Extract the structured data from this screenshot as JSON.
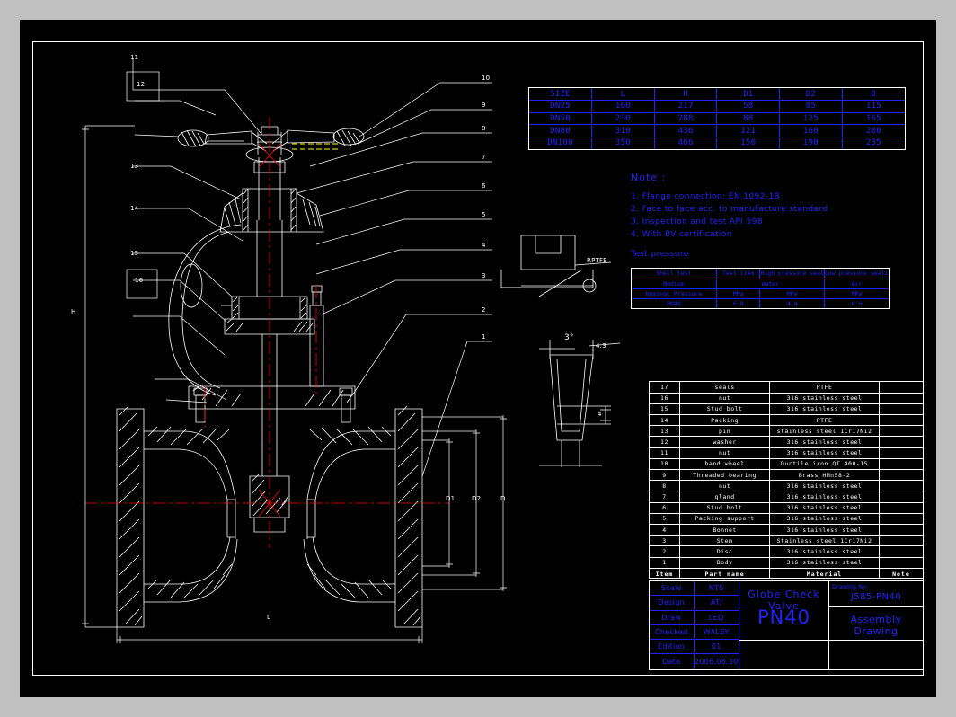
{
  "document": {
    "kind": "cad-drawing",
    "sheet_background": "#000000",
    "page_background": "#c0c0c0",
    "line_color": "#ffffff",
    "text_color_blue": "#2222ff",
    "centerline_color": "#ff0000",
    "accent_yellow": "#ffff00"
  },
  "size_table": {
    "headers": [
      "SIZE",
      "L",
      "H",
      "D1",
      "D2",
      "D"
    ],
    "rows": [
      [
        "DN25",
        "160",
        "217",
        "58",
        "85",
        "115"
      ],
      [
        "DN50",
        "230",
        "288",
        "88",
        "125",
        "165"
      ],
      [
        "DN80",
        "310",
        "436",
        "121",
        "160",
        "200"
      ],
      [
        "DN100",
        "350",
        "466",
        "150",
        "190",
        "235"
      ]
    ]
  },
  "notes": {
    "title": "Note :",
    "lines": [
      "1. Flange connection: EN 1092-1B",
      "2. Face to face acc. to manufacture standard",
      "3. Inspection and test  API 598",
      "4. With BV certification"
    ],
    "test_pressure_label": "Test pressure"
  },
  "test_pressure_table": {
    "headers": [
      "Shell test",
      "Test item",
      "High pressure sealing test",
      "Low pressure sealing test"
    ],
    "rows": [
      [
        "Medium",
        "Water",
        "Water",
        "Air"
      ],
      [
        "Nominal Pressure",
        "MPa",
        "MPa",
        "MPa"
      ],
      [
        "PN40",
        "6.0",
        "4.4",
        "0.6"
      ]
    ]
  },
  "bom": {
    "column_headers": [
      "Item",
      "Part name",
      "Material",
      "Note"
    ],
    "rows": [
      {
        "item": "17",
        "name": "seals",
        "material": "PTFE",
        "note": ""
      },
      {
        "item": "16",
        "name": "nut",
        "material": "316 stainless steel",
        "note": ""
      },
      {
        "item": "15",
        "name": "Stud bolt",
        "material": "316 stainless steel",
        "note": ""
      },
      {
        "item": "14",
        "name": "Packing",
        "material": "PTFE",
        "note": ""
      },
      {
        "item": "13",
        "name": "pin",
        "material": "stainless steel 1Cr17Ni2",
        "note": ""
      },
      {
        "item": "12",
        "name": "washer",
        "material": "316 stainless steel",
        "note": ""
      },
      {
        "item": "11",
        "name": "nut",
        "material": "316 stainless steel",
        "note": ""
      },
      {
        "item": "10",
        "name": "hand wheel",
        "material": "Ductile iron QT 400-15",
        "note": ""
      },
      {
        "item": "9",
        "name": "Threaded bearing",
        "material": "Brass HMn58-2",
        "note": ""
      },
      {
        "item": "8",
        "name": "nut",
        "material": "316 stainless steel",
        "note": ""
      },
      {
        "item": "7",
        "name": "gland",
        "material": "316 stainless steel",
        "note": ""
      },
      {
        "item": "6",
        "name": "Stud bolt",
        "material": "316 stainless steel",
        "note": ""
      },
      {
        "item": "5",
        "name": "Packing support",
        "material": "316 stainless steel",
        "note": ""
      },
      {
        "item": "4",
        "name": "Bonnet",
        "material": "316 stainless steel",
        "note": ""
      },
      {
        "item": "3",
        "name": "Stem",
        "material": "Stainless steel 1Cr17Ni2",
        "note": ""
      },
      {
        "item": "2",
        "name": "Disc",
        "material": "316 stainless steel",
        "note": ""
      },
      {
        "item": "1",
        "name": "Body",
        "material": "316 stainless steel",
        "note": ""
      }
    ]
  },
  "title_block": {
    "fields": [
      {
        "key": "Scale",
        "value": "NTS"
      },
      {
        "key": "Design",
        "value": "ATJ"
      },
      {
        "key": "Draw",
        "value": "LEQ"
      },
      {
        "key": "Checked",
        "value": "WALEY"
      },
      {
        "key": "Edition",
        "value": "01"
      },
      {
        "key": "Date",
        "value": "2006.08.30"
      }
    ],
    "product_name": "Globe Check  Valve",
    "product_rating": "PN40",
    "drawing_no_label": "Drawing No.",
    "drawing_no_value": "J585-PN40",
    "drawing_type": "Assembly Drawing"
  },
  "annotations": {
    "dim_H": "H",
    "dim_L": "L",
    "dim_D": "D",
    "dim_D1": "D1",
    "dim_D2": "D2",
    "seat_material": "RPTFE",
    "taper_angle": "3°",
    "seat_width": "4.3",
    "seat_depth": "4"
  },
  "callouts": {
    "left": [
      "11",
      "12",
      "13",
      "14",
      "15",
      "16"
    ],
    "right": [
      "10",
      "9",
      "8",
      "7",
      "6",
      "5",
      "4",
      "3",
      "2",
      "1"
    ]
  }
}
